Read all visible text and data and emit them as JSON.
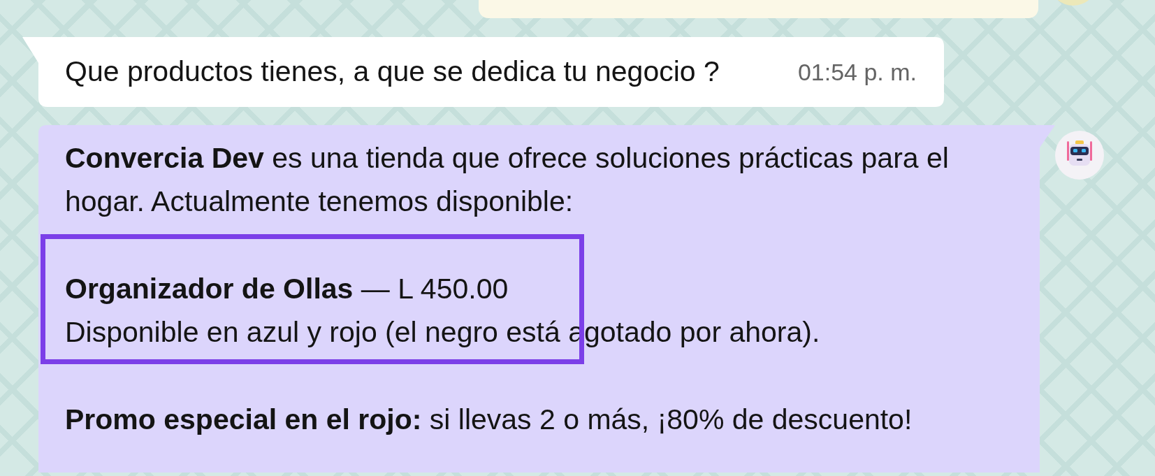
{
  "messages": [
    {
      "kind": "sent"
    },
    {
      "kind": "received",
      "text": "Que productos tienes, a que se dedica tu negocio ?",
      "time": "01:54 p. m."
    },
    {
      "kind": "bot",
      "paragraphs": [
        {
          "kind": "text",
          "text": "**Convercia Dev** es una tienda que ofrece soluciones prácticas para el hogar. Actualmente tenemos disponible:"
        },
        {
          "kind": "product",
          "title": "**Organizador de Ollas** — L 450.00",
          "description": "Disponible en azul y rojo (el negro está agotado por ahora).",
          "highlighted": true
        },
        {
          "kind": "text",
          "text": "**Promo especial en el rojo:** si llevas 2 o más, ¡80% de descuento!"
        }
      ]
    }
  ]
}
